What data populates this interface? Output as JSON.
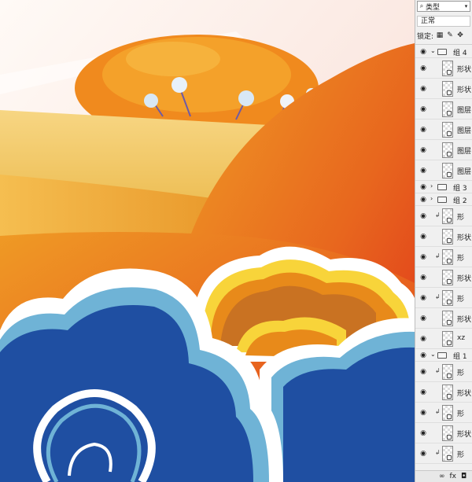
{
  "colors": {
    "sky": "#fbe9e2",
    "orange_hill": "#e8811c",
    "red_orange": "#e2401c",
    "field_yellow": "#f3c65a",
    "cloud_blue": "#1f4fa2",
    "cloud_light_blue": "#6fb3d6",
    "cloud_white": "#ffffff",
    "cloud_orange": "#e88a1a",
    "cloud_yellow": "#f8d43a",
    "tree_orange": "#f08a1e",
    "panel_bg": "#f0f0f0"
  },
  "panel": {
    "filter": {
      "search_icon": "search-icon",
      "label": "类型",
      "dropdown_icon": "chevron-down-icon",
      "extra": "▯"
    },
    "blend_mode": "正常",
    "lock": {
      "label": "锁定:",
      "icons": [
        "lock-transparent-icon",
        "brush-icon",
        "move-icon"
      ]
    },
    "layers": [
      {
        "type": "group",
        "name": "组 4",
        "expanded": true
      },
      {
        "type": "layer",
        "name": "形状"
      },
      {
        "type": "layer",
        "name": "形状"
      },
      {
        "type": "layer",
        "name": "图层"
      },
      {
        "type": "layer",
        "name": "图层"
      },
      {
        "type": "layer",
        "name": "图层"
      },
      {
        "type": "layer",
        "name": "图层"
      },
      {
        "type": "group",
        "name": "组 3",
        "expanded": false
      },
      {
        "type": "group",
        "name": "组 2",
        "expanded": false
      },
      {
        "type": "layer",
        "name": "形",
        "clipped": true
      },
      {
        "type": "layer",
        "name": "形状"
      },
      {
        "type": "layer",
        "name": "形",
        "clipped": true
      },
      {
        "type": "layer",
        "name": "形状"
      },
      {
        "type": "layer",
        "name": "形",
        "clipped": true
      },
      {
        "type": "layer",
        "name": "形状"
      },
      {
        "type": "layer",
        "name": "xz"
      },
      {
        "type": "group",
        "name": "组 1",
        "expanded": true
      },
      {
        "type": "layer",
        "name": "形",
        "clipped": true
      },
      {
        "type": "layer",
        "name": "形状"
      },
      {
        "type": "layer",
        "name": "形",
        "clipped": true
      },
      {
        "type": "layer",
        "name": "形状"
      },
      {
        "type": "layer",
        "name": "形",
        "clipped": true
      }
    ],
    "footer": {
      "link": "∞",
      "fx": "fx",
      "mask": "◘"
    }
  }
}
